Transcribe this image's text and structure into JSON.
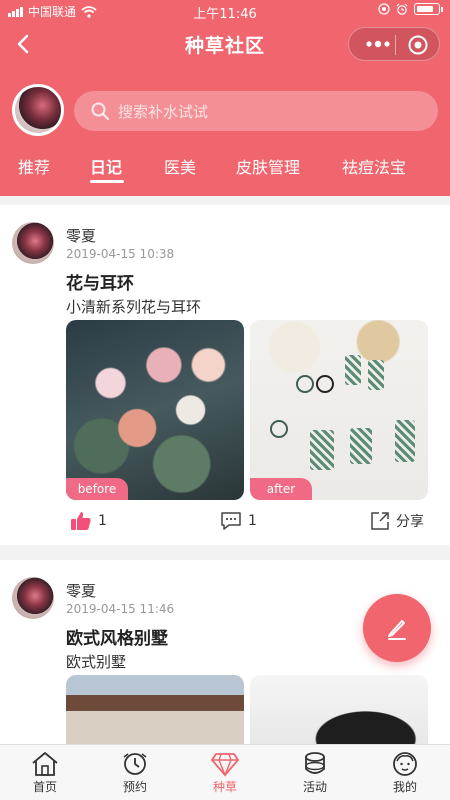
{
  "status_bar": {
    "carrier": "中国联通",
    "time": "上午11:46"
  },
  "header": {
    "title": "种草社区",
    "search_placeholder": "搜索补水试试"
  },
  "tabs": [
    {
      "label": "推荐"
    },
    {
      "label": "日记"
    },
    {
      "label": "医美"
    },
    {
      "label": "皮肤管理"
    },
    {
      "label": "祛痘法宝"
    }
  ],
  "active_tab": "日记",
  "posts": [
    {
      "user": "零夏",
      "time": "2019-04-15 10:38",
      "title": "花与耳环",
      "desc": "小清新系列花与耳环",
      "photo_tags": [
        "before",
        "after"
      ],
      "likes": "1",
      "comments": "1",
      "share_label": "分享"
    },
    {
      "user": "零夏",
      "time": "2019-04-15 11:46",
      "title": "欧式风格别墅",
      "desc": "欧式别墅"
    }
  ],
  "bottom_nav": [
    {
      "label": "首页",
      "icon": "home-icon"
    },
    {
      "label": "预约",
      "icon": "appointment-icon"
    },
    {
      "label": "种草",
      "icon": "diamond-icon"
    },
    {
      "label": "活动",
      "icon": "activity-icon"
    },
    {
      "label": "我的",
      "icon": "profile-icon"
    }
  ],
  "colors": {
    "brand": "#f0656e",
    "tag": "#f06a86",
    "like": "#f0507a"
  }
}
